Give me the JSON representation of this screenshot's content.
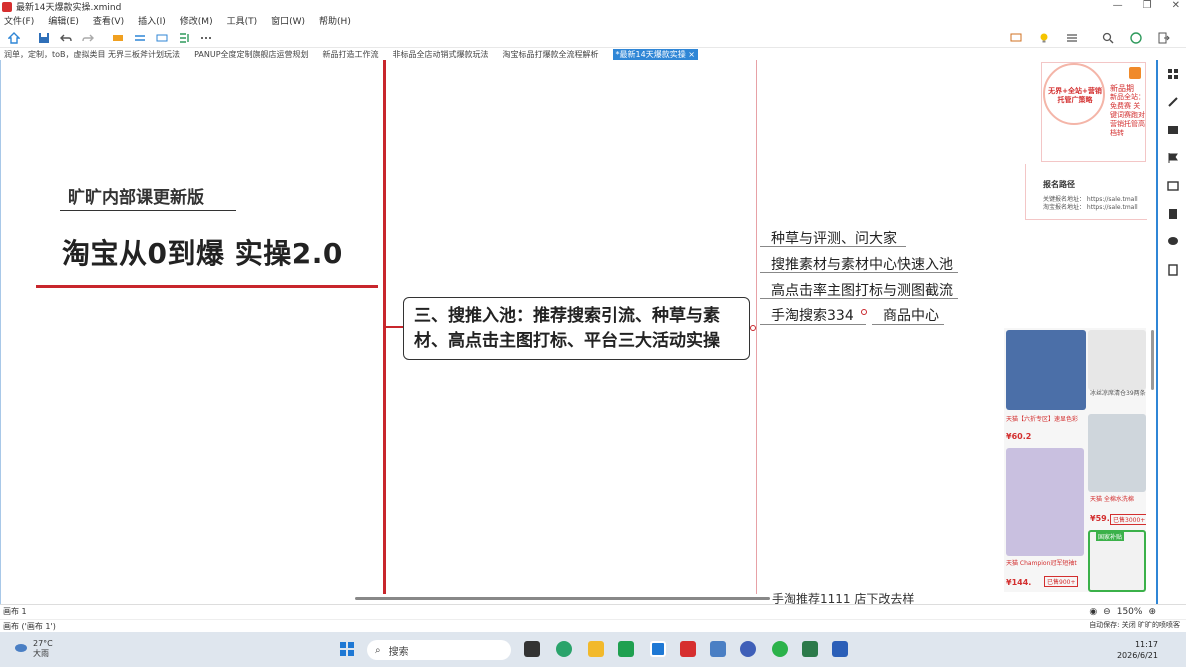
{
  "window": {
    "title": "最新14天爆款实操.xmind",
    "controls": [
      "—",
      "❐",
      "✕"
    ]
  },
  "menu": [
    "文件(F)",
    "编辑(E)",
    "查看(V)",
    "插入(I)",
    "修改(M)",
    "工具(T)",
    "窗口(W)",
    "帮助(H)"
  ],
  "tabs": [
    {
      "label": "润单，定制，toB，虚拟类目 无界三板斧计划玩法",
      "active": false
    },
    {
      "label": "PANUP全度定制旗舰店运营规划",
      "active": false
    },
    {
      "label": "新品打造工作流",
      "active": false
    },
    {
      "label": "非标品全店动销式爆款玩法",
      "active": false
    },
    {
      "label": "淘宝标品打爆款全流程解析",
      "active": false
    },
    {
      "label": "*最新14天爆款实操 ×",
      "active": true
    }
  ],
  "mindmap": {
    "subtitle": "旷旷内部课更新版",
    "title": "淘宝从0到爆 实操2.0",
    "central_topic_line1": "三、搜推入池：推荐搜索引流、种草与素",
    "central_topic_line2": "材、高点击主图打标、平台三大活动实操",
    "children": [
      "种草与评测、问大家",
      "搜推素材与素材中心快速入池",
      "高点击率主图打标与测图截流",
      "手淘搜索334"
    ],
    "child_sub": "商品中心",
    "cut_bottom_text": "手淘推荐1111        店下改去样"
  },
  "promo": {
    "circle_text": "无界+全站+营销托管广策略",
    "right_title": "新品期",
    "right_text": "新品全站：免费赛 关键词赛跑对 营销托管高档转",
    "apply_title": "报名路径",
    "apply_line1": "关键报名地址： https://sale.tmall",
    "apply_line2": "淘宝报名地址： https://sale.tmall"
  },
  "products": {
    "p1_tag": "天猫【六折专区】速显色彩",
    "p1_price": "¥60.2",
    "p2_tag": "冰丝凉席清仓39两条",
    "p3_tag": "天猫 Champion冠军短袖t",
    "p3_price": "¥144.",
    "p3_sold": "已售900+",
    "p4_tag": "天猫 全棉水洗棉",
    "p4_price": "¥59.",
    "p4_sold": "已售3000+",
    "p5_tag": "国家补贴"
  },
  "sheet": {
    "name": "画布 1",
    "status": "画布 ('画布 1')",
    "zoom": "150%",
    "autosave": "自动保存: 关闭  旷旷的喷喷客"
  },
  "taskbar": {
    "temperature": "27°C",
    "weather": "大雨",
    "search_placeholder": "搜索",
    "time": "11:17",
    "date": "2026/6/21"
  }
}
